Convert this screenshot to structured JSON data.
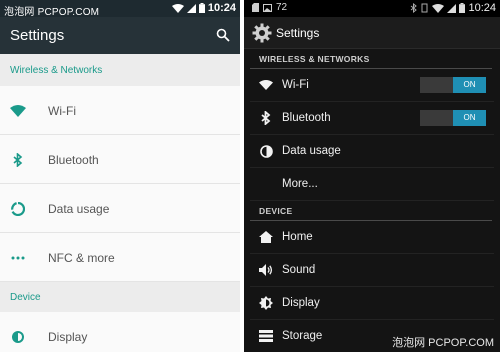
{
  "left": {
    "status": {
      "watermark": "泡泡网 PCPOP.COM",
      "time": "10:24"
    },
    "app_title": "Settings",
    "sections": [
      {
        "title": "Wireless & Networks",
        "items": [
          {
            "label": "Wi-Fi",
            "icon": "wifi-icon"
          },
          {
            "label": "Bluetooth",
            "icon": "bluetooth-icon"
          },
          {
            "label": "Data usage",
            "icon": "data-usage-icon"
          },
          {
            "label": "NFC & more",
            "icon": "more-dots-icon"
          }
        ]
      },
      {
        "title": "Device",
        "items": [
          {
            "label": "Display",
            "icon": "display-icon"
          }
        ]
      }
    ],
    "accent": "#1a9a8a",
    "toolbar_color": "#263238"
  },
  "right": {
    "status": {
      "battery": "72",
      "time": "10:24"
    },
    "app_title": "Settings",
    "wireless_title": "WIRELESS & NETWORKS",
    "wifi": {
      "label": "Wi-Fi",
      "toggle": "ON"
    },
    "bluetooth": {
      "label": "Bluetooth",
      "toggle": "ON"
    },
    "data_usage": {
      "label": "Data usage"
    },
    "more": {
      "label": "More..."
    },
    "device_title": "DEVICE",
    "home": {
      "label": "Home"
    },
    "sound": {
      "label": "Sound"
    },
    "display": {
      "label": "Display"
    },
    "storage": {
      "label": "Storage"
    },
    "watermark": "泡泡网 PCPOP.COM",
    "accent": "#1f8fb4"
  }
}
